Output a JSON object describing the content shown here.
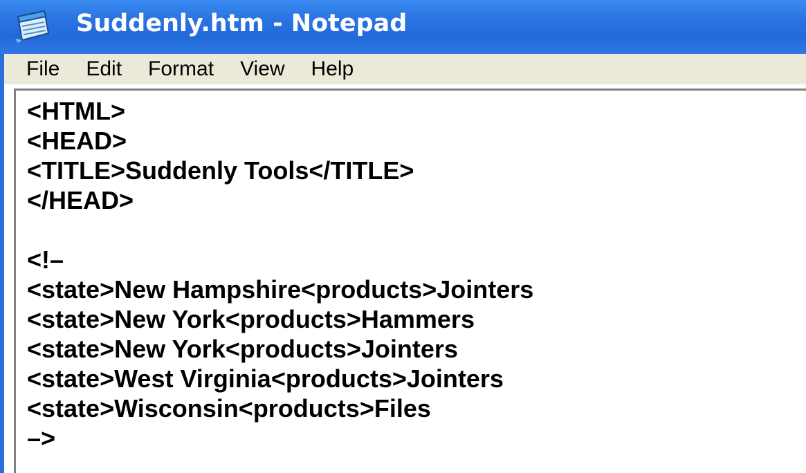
{
  "window": {
    "title": "Suddenly.htm - Notepad",
    "icon": "notepad-icon"
  },
  "menu": {
    "items": [
      "File",
      "Edit",
      "Format",
      "View",
      "Help"
    ]
  },
  "editor": {
    "lines": [
      "<HTML>",
      "<HEAD>",
      "<TITLE>Suddenly Tools</TITLE>",
      "</HEAD>",
      "",
      "<!–",
      "<state>New Hampshire<products>Jointers",
      "<state>New York<products>Hammers",
      "<state>New York<products>Jointers",
      "<state>West Virginia<products>Jointers",
      "<state>Wisconsin<products>Files",
      "–>"
    ]
  },
  "colors": {
    "titlebar": "#2a73e3",
    "menubar": "#ece9d8",
    "editor_bg": "#ffffff"
  }
}
